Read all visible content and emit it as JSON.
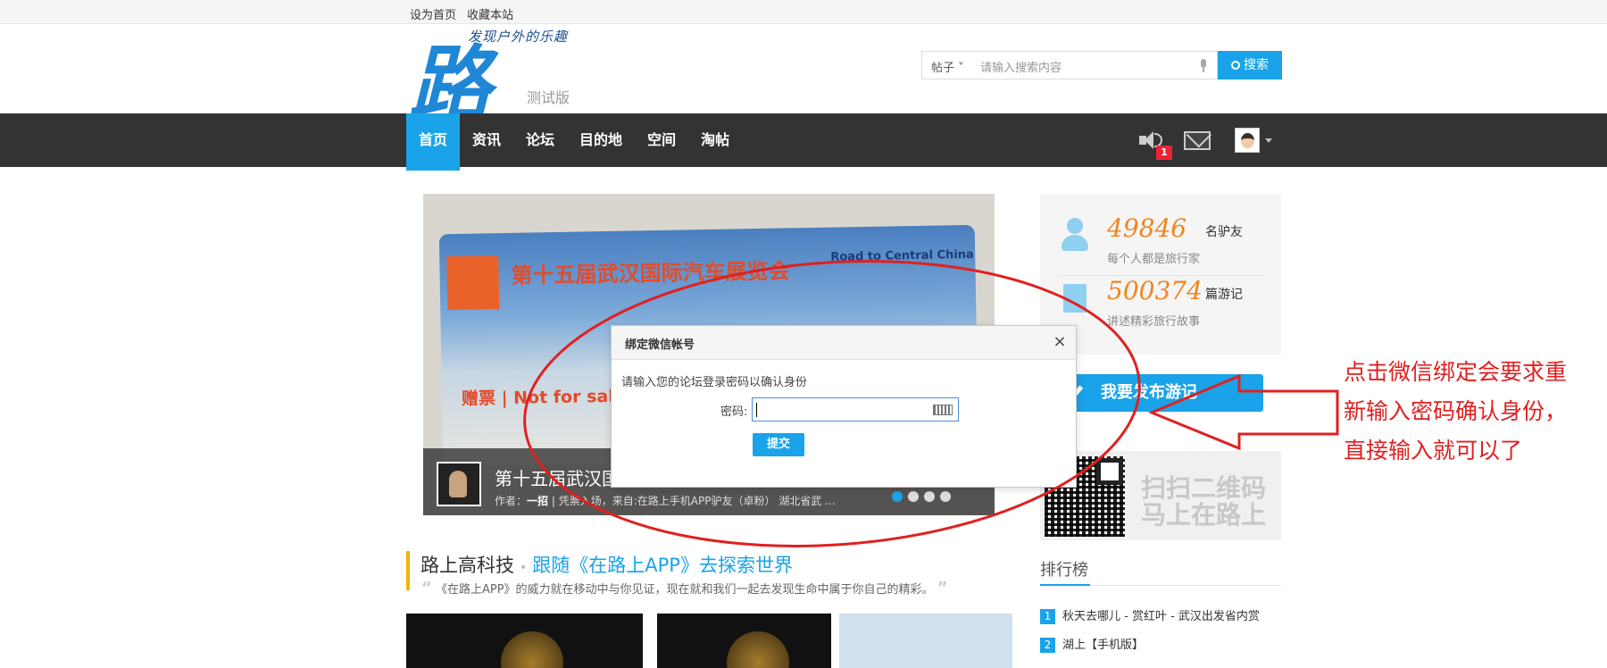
{
  "topbar": {
    "set_home": "设为首页",
    "bookmark": "收藏本站"
  },
  "logo": {
    "char": "路",
    "slogan": "发现户外的乐趣",
    "beta": "测试版"
  },
  "search": {
    "scope": "帖子",
    "placeholder": "请输入搜索内容",
    "button": "搜索"
  },
  "nav": {
    "items": [
      "首页",
      "资讯",
      "论坛",
      "目的地",
      "空间",
      "淘帖"
    ],
    "notification_count": "1"
  },
  "slider": {
    "card_title": "第十五届武汉国际汽车展览会",
    "card_road": "Road to Central China",
    "card_gift": "赠票 | Not for sale",
    "caption_title": "第十五届武汉国际",
    "caption_author_label": "作者：",
    "caption_author": "一招",
    "caption_rest": "| 凭票入场，来自:在路上手机APP驴友（卓粉） 湖北省武 ..."
  },
  "section": {
    "heading": "路上高科技",
    "link": "跟随《在路上APP》去探索世界",
    "desc": "《在路上APP》的威力就在移动中与你见证，现在就和我们一起去发现生命中属于你自己的精彩。"
  },
  "stats": {
    "members_num": "49846",
    "members_unit": "名驴友",
    "members_desc": "每个人都是旅行家",
    "notes_num": "500374",
    "notes_unit": "篇游记",
    "notes_desc": "讲述精彩旅行故事"
  },
  "publish": "我要发布游记",
  "qr": {
    "line1": "扫扫二维码",
    "line2": "马上在路上"
  },
  "rank": {
    "title": "排行榜",
    "items": [
      {
        "n": "1",
        "text": "秋天去哪儿 - 赏红叶 - 武汉出发省内赏"
      },
      {
        "n": "2",
        "text": "湖上【手机版】"
      }
    ]
  },
  "modal": {
    "title": "绑定微信帐号",
    "close": "×",
    "prompt": "请输入您的论坛登录密码以确认身份",
    "pwd_label": "密码:",
    "submit": "提交"
  },
  "annotation": {
    "text": "点击微信绑定会要求重新输入密码确认身份，直接输入就可以了",
    "color": "#e02020"
  }
}
